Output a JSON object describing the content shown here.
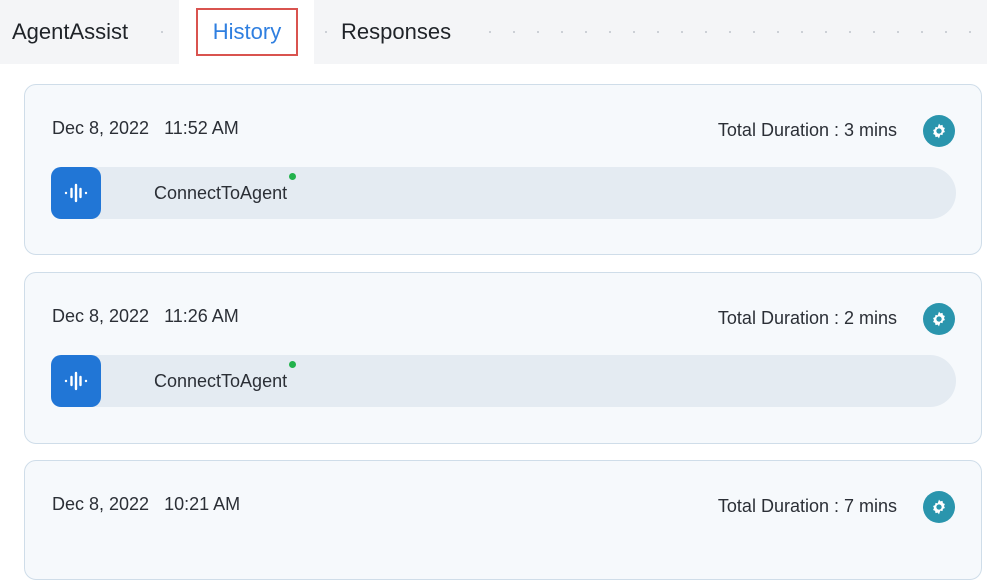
{
  "tabs": {
    "agentassist": "AgentAssist",
    "history": "History",
    "responses": "Responses"
  },
  "colors": {
    "accent": "#2f7fe0",
    "highlight_border": "#d9534f",
    "gear_icon_bg": "#2a95ad",
    "voice_icon_bg": "#2176d6",
    "status_dot": "#22b24c"
  },
  "history": [
    {
      "date": "Dec 8, 2022   11:52 AM",
      "duration": "Total Duration : 3 mins",
      "icon": "voice-wave-icon",
      "label": "ConnectToAgent"
    },
    {
      "date": "Dec 8, 2022   11:26 AM",
      "duration": "Total Duration : 2 mins",
      "icon": "voice-wave-icon",
      "label": "ConnectToAgent"
    },
    {
      "date": "Dec 8, 2022   10:21 AM",
      "duration": "Total Duration : 7 mins",
      "icon": "gear-icon"
    }
  ]
}
